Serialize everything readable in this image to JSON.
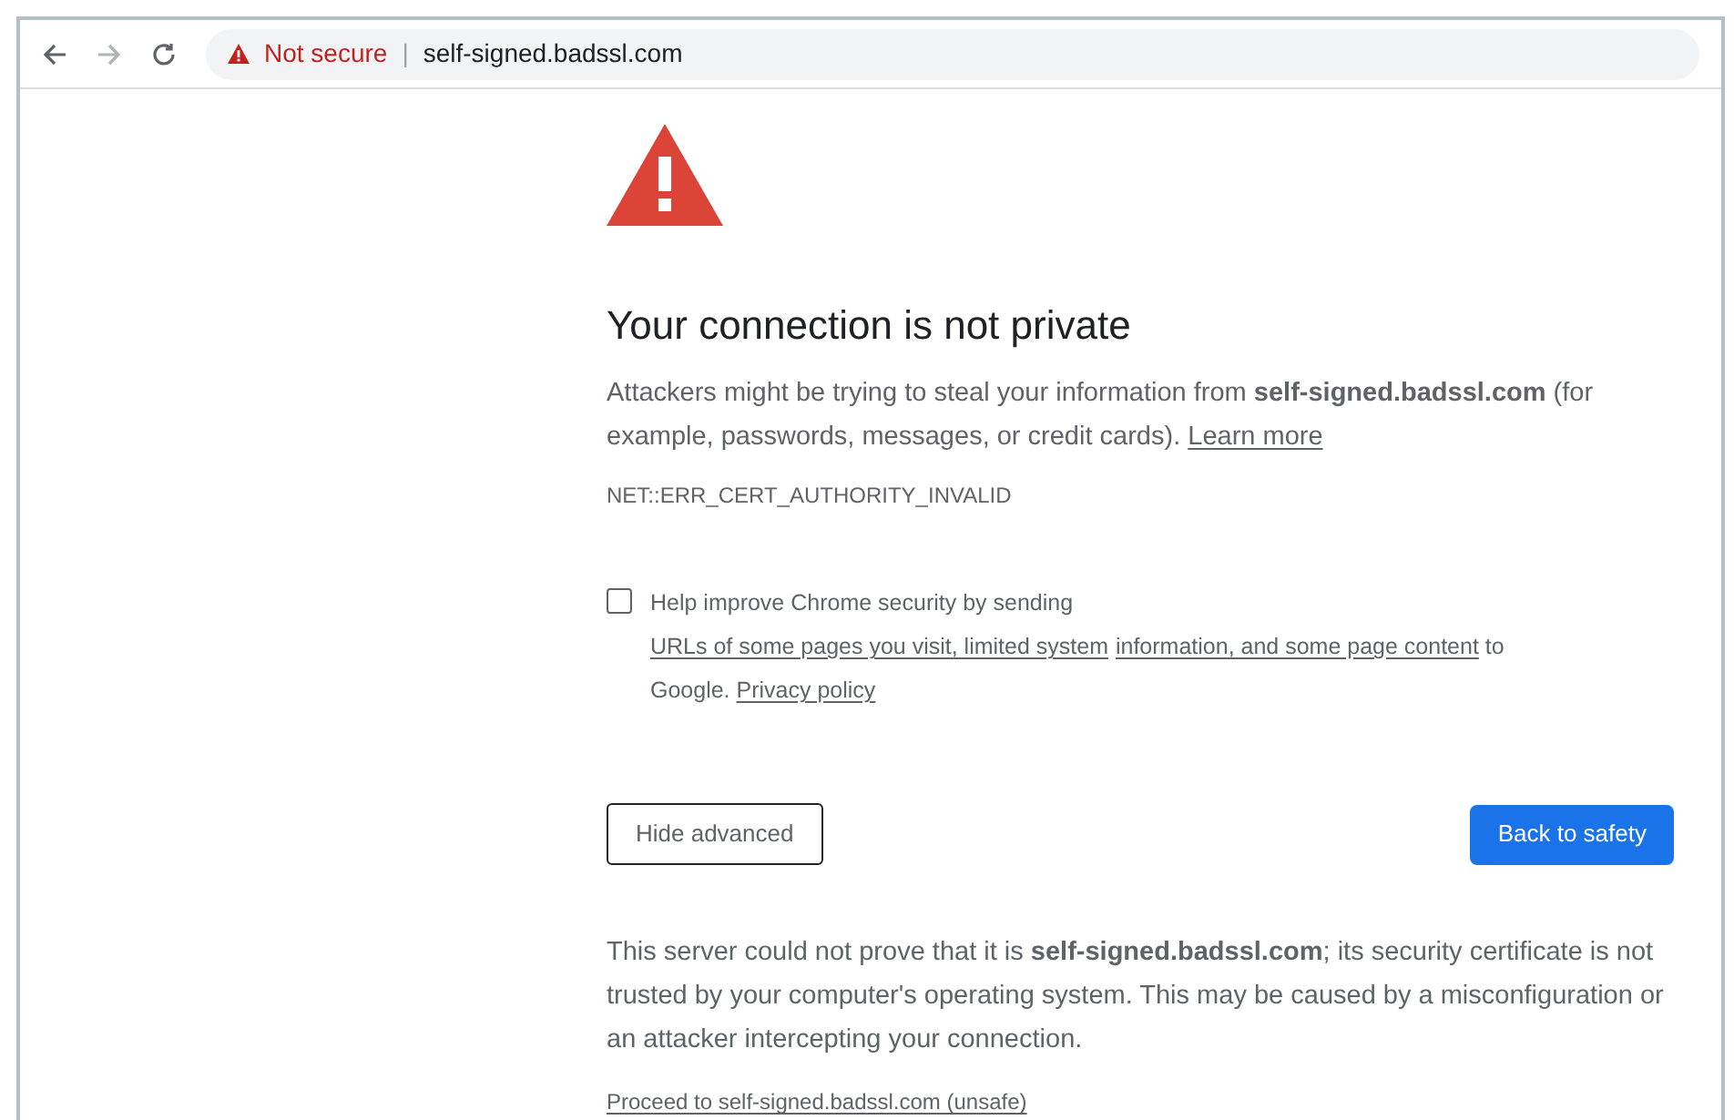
{
  "toolbar": {
    "security_label": "Not secure",
    "separator": "|",
    "url": "self-signed.badssl.com"
  },
  "heading": "Your connection is not private",
  "intro": [
    {
      "kind": "text",
      "text": "Attackers might be trying to steal your information from **self-signed.badssl.com** (for example, passwords, messages, or credit cards). "
    },
    {
      "kind": "link",
      "text": "Learn more"
    }
  ],
  "error_code": "NET::ERR_CERT_AUTHORITY_INVALID",
  "opt_in": {
    "checked": false,
    "segments": [
      {
        "kind": "text",
        "text": "Help improve Chrome security by sending "
      },
      {
        "kind": "link",
        "text": "URLs of some pages you visit, limited system"
      },
      {
        "kind": "link",
        "text": "information, and some page content"
      },
      {
        "kind": "text",
        "text": " to Google. "
      },
      {
        "kind": "link",
        "text": "Privacy policy"
      }
    ]
  },
  "buttons": {
    "secondary": "Hide advanced",
    "primary": "Back to safety"
  },
  "details": "This server could not prove that it is **self-signed.badssl.com**; its security certificate is not trusted by your computer's operating system. This may be caused by a misconfiguration or an attacker intercepting your connection.",
  "proceed_link": "Proceed to self-signed.badssl.com (unsafe)"
}
